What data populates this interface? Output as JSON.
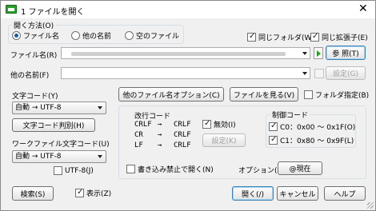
{
  "window": {
    "title": "1 ファイルを開く",
    "close_glyph": "✕"
  },
  "open_method": {
    "label": "開く方法(O)",
    "options": [
      "ファイル名",
      "他の名前",
      "空のファイル"
    ],
    "selected": 0
  },
  "same_folder": {
    "label": "同じフォルダ(W)",
    "checked": true
  },
  "same_ext": {
    "label": "同じ拡張子(E)",
    "checked": true
  },
  "filename": {
    "label": "ファイル名(R)",
    "value": ""
  },
  "browse_button": "参 照(T)",
  "other_name": {
    "label": "他の名前(F)",
    "value": ""
  },
  "settings_button": "設定(G)",
  "char_code": {
    "label": "文字コード(Y)",
    "value": "自動 → UTF-8"
  },
  "char_code_detect_button": "文字コード判別(H)",
  "work_char_code": {
    "label": "ワークファイル文字コード(U)",
    "value": "自動 → UTF-8"
  },
  "utf8_j": {
    "label": "UTF-8(J)",
    "checked": false
  },
  "other_options_button": "他のファイル名オプション(C)",
  "view_file_button": "ファイルを見る(V)",
  "folder_specify": {
    "label": "フォルダ指定(B)",
    "checked": false
  },
  "newline": {
    "title": "改行コード",
    "rows": [
      {
        "from": "CRLF",
        "arrow": "→",
        "to": "CRLF"
      },
      {
        "from": "CR",
        "arrow": "→",
        "to": "CRLF"
      },
      {
        "from": "LF",
        "arrow": "→",
        "to": "CRLF"
      }
    ],
    "invalid": {
      "label": "無効(I)",
      "checked": true
    },
    "settings_button": "設定(K)"
  },
  "control_code": {
    "title": "制御コード",
    "c0": {
      "label": "C0：0x00 ～ 0x1F(O)",
      "checked": true
    },
    "c1": {
      "label": "C1：0x80 ～ 0x9F(L)",
      "checked": true
    }
  },
  "write_protect": {
    "label": "書き込み禁止で開く(N)",
    "checked": false
  },
  "option": {
    "label": "オプション(M)",
    "button": "@現在"
  },
  "search_button": "検索(S)",
  "display": {
    "label": "表示(Z)",
    "checked": true
  },
  "open_button": "開く(/)",
  "cancel_button": "キャンセル",
  "help_button": "ヘルプ"
}
